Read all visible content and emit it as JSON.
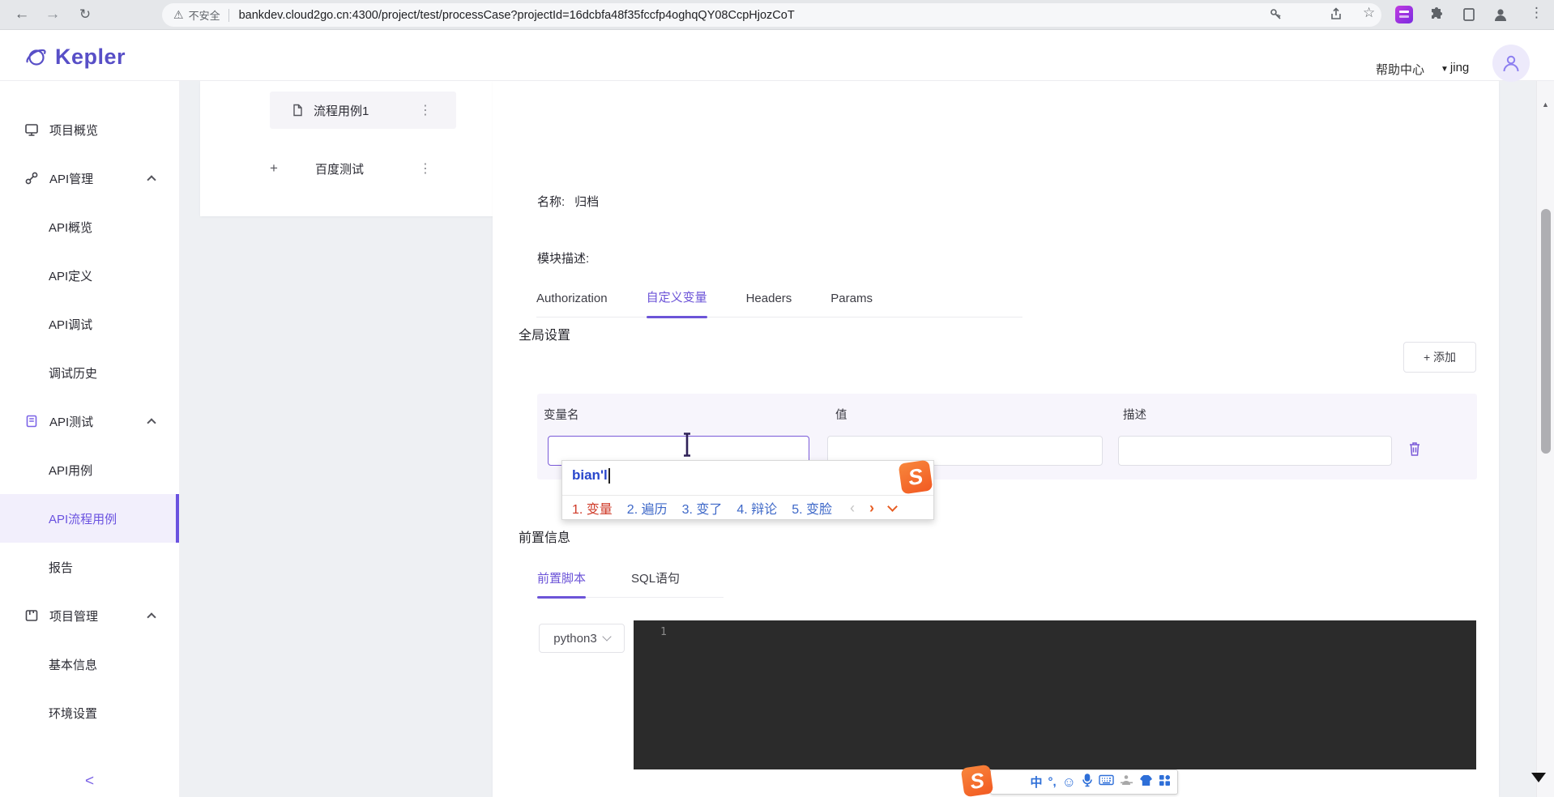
{
  "browser": {
    "back_icon": "←",
    "forward_icon": "→",
    "reload_icon": "↻",
    "warning_icon": "⚠",
    "security_label": "不安全",
    "url": "bankdev.cloud2go.cn:4300/project/test/processCase?projectId=16dcbfa48f35fccfp4oghqQY08CcpHjozCoT",
    "star_icon": "☆",
    "menu_icon": "⋮"
  },
  "header": {
    "logo_text": "Kepler",
    "help_label": "帮助中心",
    "user_caret": "▼",
    "user_name": "jing"
  },
  "sidebar": {
    "items": [
      {
        "label": "项目概览"
      },
      {
        "label": "API管理"
      },
      {
        "label": "API概览"
      },
      {
        "label": "API定义"
      },
      {
        "label": "API调试"
      },
      {
        "label": "调试历史"
      },
      {
        "label": "API测试"
      },
      {
        "label": "API用例"
      },
      {
        "label": "API流程用例"
      },
      {
        "label": "报告"
      },
      {
        "label": "项目管理"
      },
      {
        "label": "基本信息"
      },
      {
        "label": "环境设置"
      }
    ],
    "collapse_label": "<"
  },
  "tree": {
    "item1": {
      "label": "流程用例1",
      "menu_icon": "⋮"
    },
    "item2": {
      "label": "百度测试",
      "plus_icon": "+",
      "menu_icon": "⋮"
    }
  },
  "main": {
    "name_label": "名称:",
    "name_value": "归档",
    "module_desc_label": "模块描述:",
    "global_settings_title": "全局设置",
    "tabs": [
      {
        "label": "Authorization"
      },
      {
        "label": "自定义变量"
      },
      {
        "label": "Headers"
      },
      {
        "label": "Params"
      }
    ],
    "add_button_label": "+ 添加",
    "table": {
      "headers": [
        "变量名",
        "值",
        "描述"
      ]
    },
    "pre_info_title": "前置信息",
    "pre_tabs": [
      {
        "label": "前置脚本"
      },
      {
        "label": "SQL语句"
      }
    ],
    "language_select_value": "python3",
    "editor_first_line_number": "1"
  },
  "ime": {
    "composition": "bian'l",
    "candidates": [
      "1. 变量",
      "2. 遍历",
      "3. 变了",
      "4. 辩论",
      "5. 变脸"
    ],
    "prev_arrow": "‹",
    "next_arrow": "›",
    "logo_letter": "S"
  },
  "ime_toolbar": {
    "logo_letter": "S",
    "mode_label": "中",
    "punct_label": "°,",
    "smiley_icon": "☺"
  },
  "colors": {
    "accent": "#6a52e0",
    "sogou_orange": "#f25a22",
    "editor_bg": "#2b2b2b"
  }
}
